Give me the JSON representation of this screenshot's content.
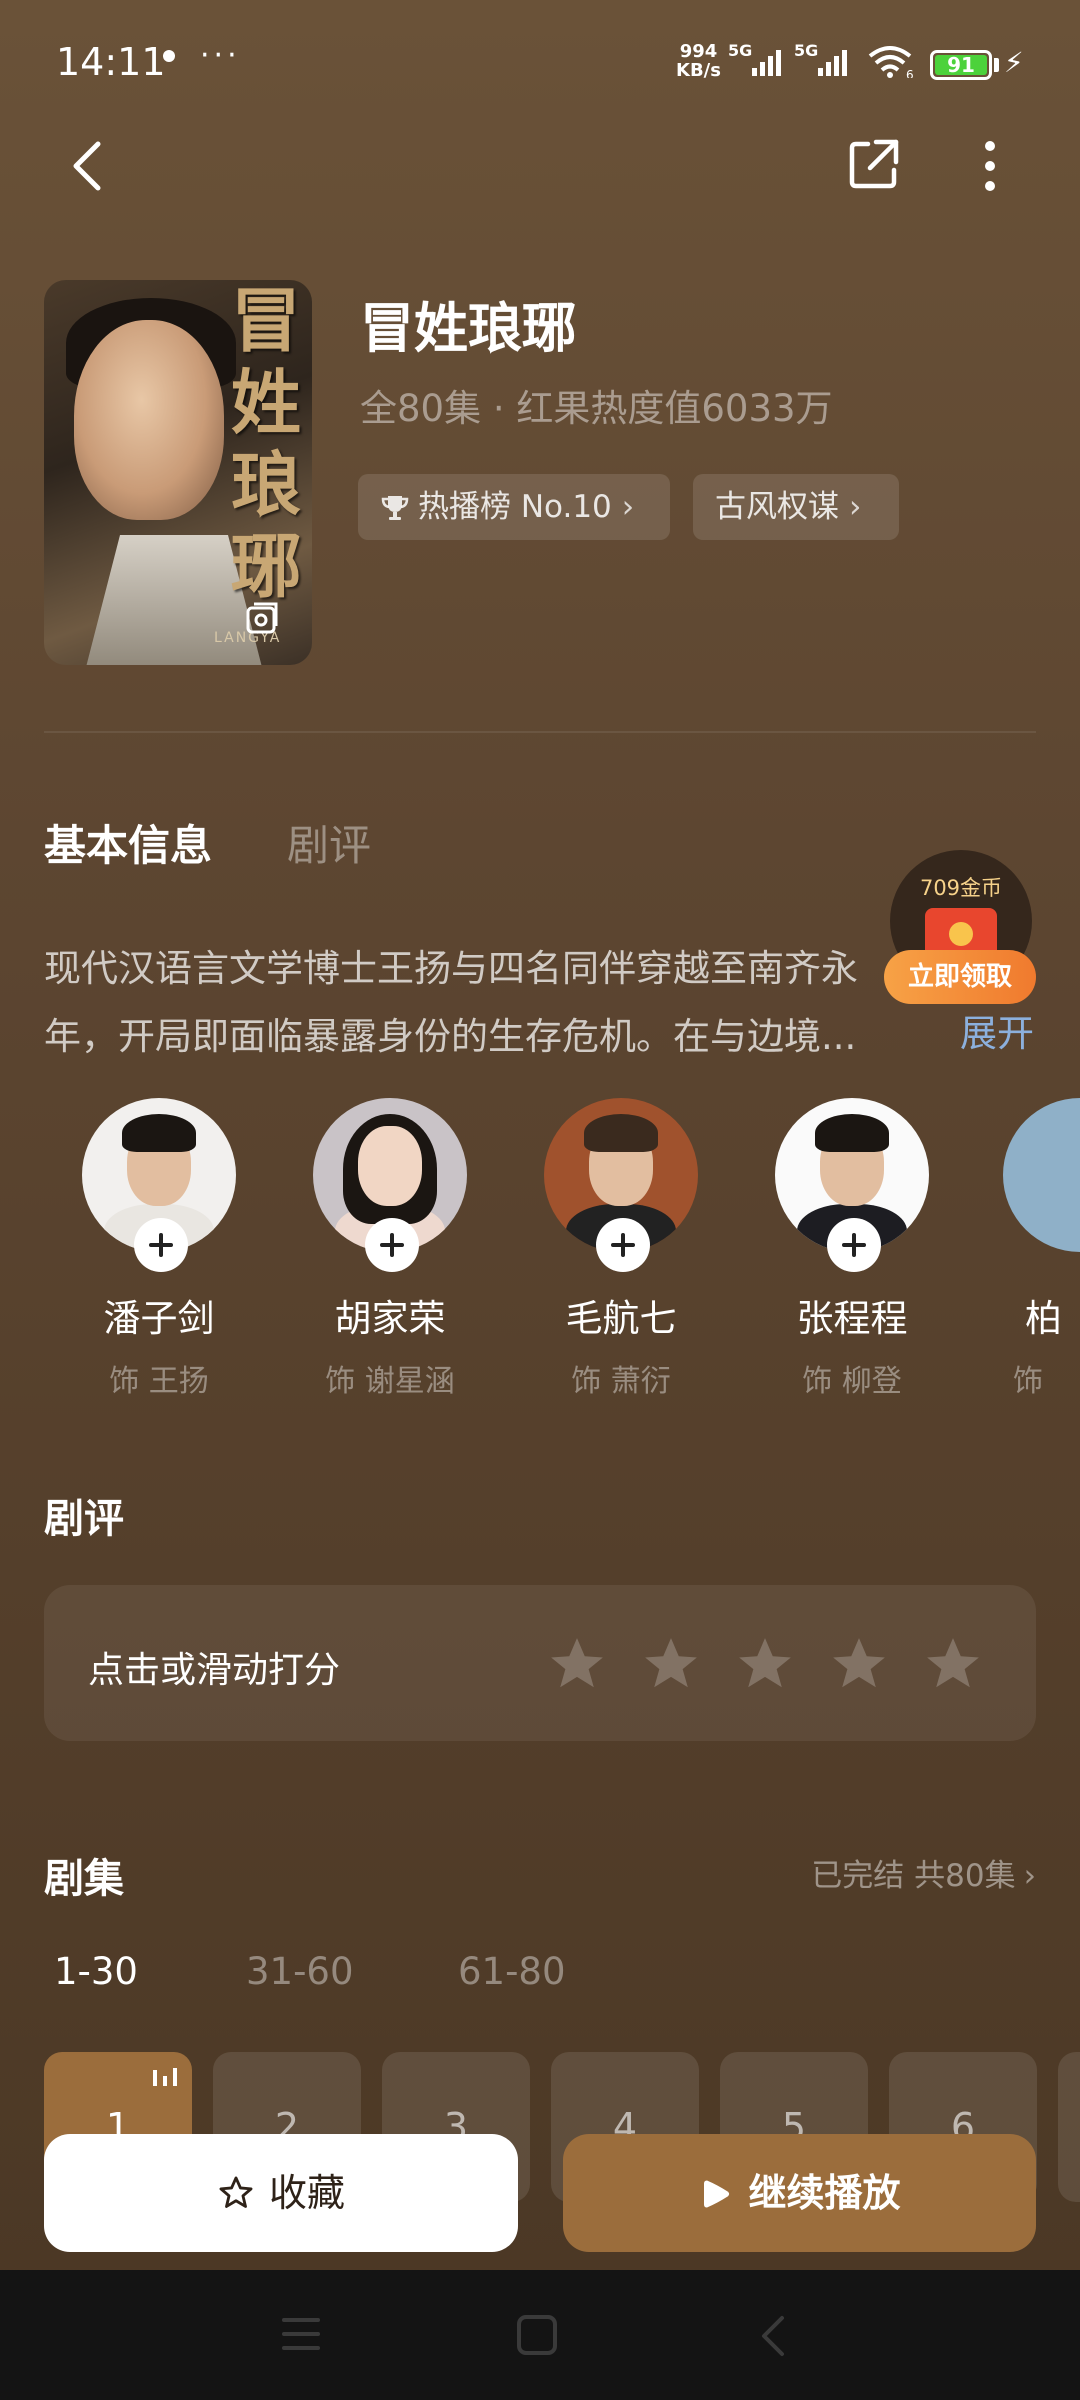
{
  "status_bar": {
    "time": "14:11",
    "net_speed_value": "994",
    "net_speed_unit": "KB/s",
    "battery": "91",
    "signal1": "5G",
    "signal2": "5G",
    "wifi": "6"
  },
  "drama": {
    "title": "冒姓琅琊",
    "meta": "全80集 · 红果热度值6033万",
    "tags": [
      "热播榜 No.10",
      "古风权谋"
    ],
    "poster_title": "冒姓琅琊",
    "poster_en": "LANGYA"
  },
  "tabs": {
    "basic": "基本信息",
    "review": "剧评"
  },
  "synopsis": {
    "line1": "现代汉语言文学博士王扬与四名同伴穿越至南齐永",
    "line2": "年，开局即面临暴露身份的生存危机。在与边境...",
    "expand": "展开"
  },
  "reward": {
    "coins": "709金币",
    "button": "立即领取"
  },
  "cast": [
    {
      "name": "潘子剑",
      "role": "饰 王扬"
    },
    {
      "name": "胡家荣",
      "role": "饰 谢星涵"
    },
    {
      "name": "毛航七",
      "role": "饰 萧衍"
    },
    {
      "name": "张程程",
      "role": "饰 柳登"
    },
    {
      "name": "柏",
      "role": "饰"
    }
  ],
  "rating": {
    "section_title": "剧评",
    "prompt": "点击或滑动打分",
    "stars": 0,
    "max_stars": 5
  },
  "episodes": {
    "section_title": "剧集",
    "status": "已完结 共80集",
    "ranges": [
      "1-30",
      "31-60",
      "61-80"
    ],
    "selected_range": "1-30",
    "items": [
      "1",
      "2",
      "3",
      "4",
      "5",
      "6"
    ],
    "current": "1"
  },
  "actions": {
    "favorite": "收藏",
    "continue": "继续播放"
  },
  "colors": {
    "accent": "#9b6d3c",
    "background": "#5d4631",
    "link": "#8cb0dd",
    "coin_orange": "#f07a2e"
  }
}
